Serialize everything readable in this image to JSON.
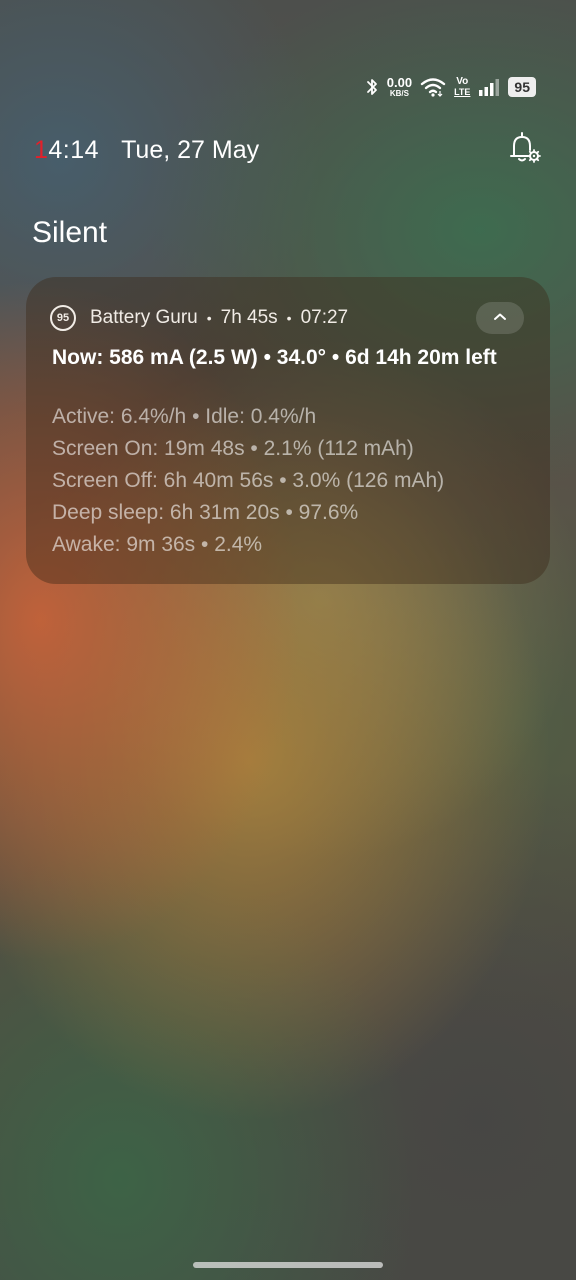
{
  "status_bar": {
    "net_speed_value": "0.00",
    "net_speed_unit": "KB/S",
    "volte_top": "Vo",
    "volte_bottom": "LTE",
    "battery_level": "95",
    "icons": [
      "bluetooth-icon",
      "wifi-icon",
      "signal-icon",
      "battery-icon"
    ]
  },
  "header": {
    "time_first_digit": "1",
    "time_rest": "4:14",
    "date": "Tue, 27 May",
    "accent_color": "#e3202a"
  },
  "section": {
    "title": "Silent"
  },
  "notification": {
    "app_icon_text": "95",
    "app_name": "Battery Guru",
    "duration": "7h 45s",
    "time": "07:27",
    "title": "Now: 586 mA (2.5 W) • 34.0° • 6d 14h 20m left",
    "lines": [
      "Active: 6.4%/h • Idle: 0.4%/h",
      "Screen On: 19m 48s • 2.1% (112 mAh)",
      "Screen Off: 6h 40m 56s • 3.0% (126 mAh)",
      "Deep sleep: 6h 31m 20s • 97.6%",
      "Awake: 9m 36s • 2.4%"
    ]
  }
}
